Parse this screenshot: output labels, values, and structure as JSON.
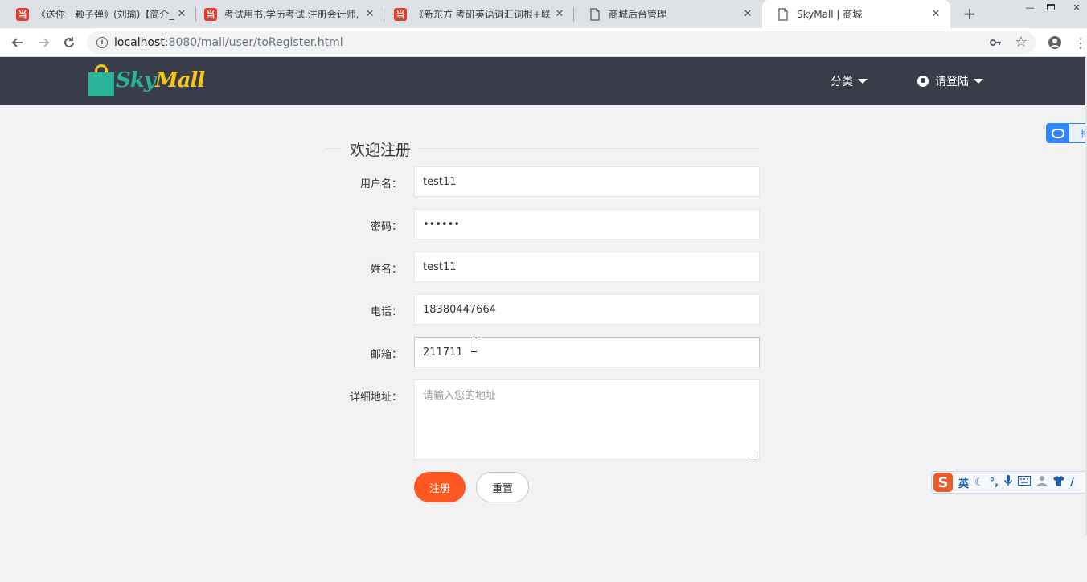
{
  "browser": {
    "tabs": [
      {
        "title": "《送你一颗子弹》(刘瑜)【简介_",
        "favicon": "dangdang-icon",
        "active": false
      },
      {
        "title": "考试用书,学历考试,注册会计师,",
        "favicon": "dangdang-icon",
        "active": false
      },
      {
        "title": "《新东方 考研英语词汇词根+联",
        "favicon": "dangdang-icon",
        "active": false
      },
      {
        "title": "商城后台管理",
        "favicon": "page-icon",
        "active": false
      },
      {
        "title": "SkyMall | 商城",
        "favicon": "page-icon",
        "active": true
      }
    ],
    "favicon_glyph": "当",
    "new_tab_glyph": "+",
    "url_host": "localhost",
    "url_path": ":8080/mall/user/toRegister.html"
  },
  "header": {
    "logo_text_1": "Sky",
    "logo_text_2": "Mall",
    "nav_category": "分类",
    "nav_login": "请登陆",
    "colors": {
      "bar": "#393d49",
      "logo_green": "#2bb39a",
      "logo_yellow": "#f5c518"
    }
  },
  "form": {
    "legend": "欢迎注册",
    "fields": {
      "username": {
        "label": "用户名：",
        "value": "test11"
      },
      "password": {
        "label": "密码：",
        "value": "••••••"
      },
      "name": {
        "label": "姓名：",
        "value": "test11"
      },
      "phone": {
        "label": "电话：",
        "value": "18380447664"
      },
      "email": {
        "label": "邮箱：",
        "value": "211711"
      },
      "address": {
        "label": "详细地址：",
        "value": "",
        "placeholder": "请输入您的地址"
      }
    },
    "submit_label": "注册",
    "reset_label": "重置",
    "colors": {
      "primary": "#ff5722"
    }
  },
  "widgets": {
    "baidu_text": "拖",
    "ime_logo": "S",
    "ime_mode": "英"
  }
}
